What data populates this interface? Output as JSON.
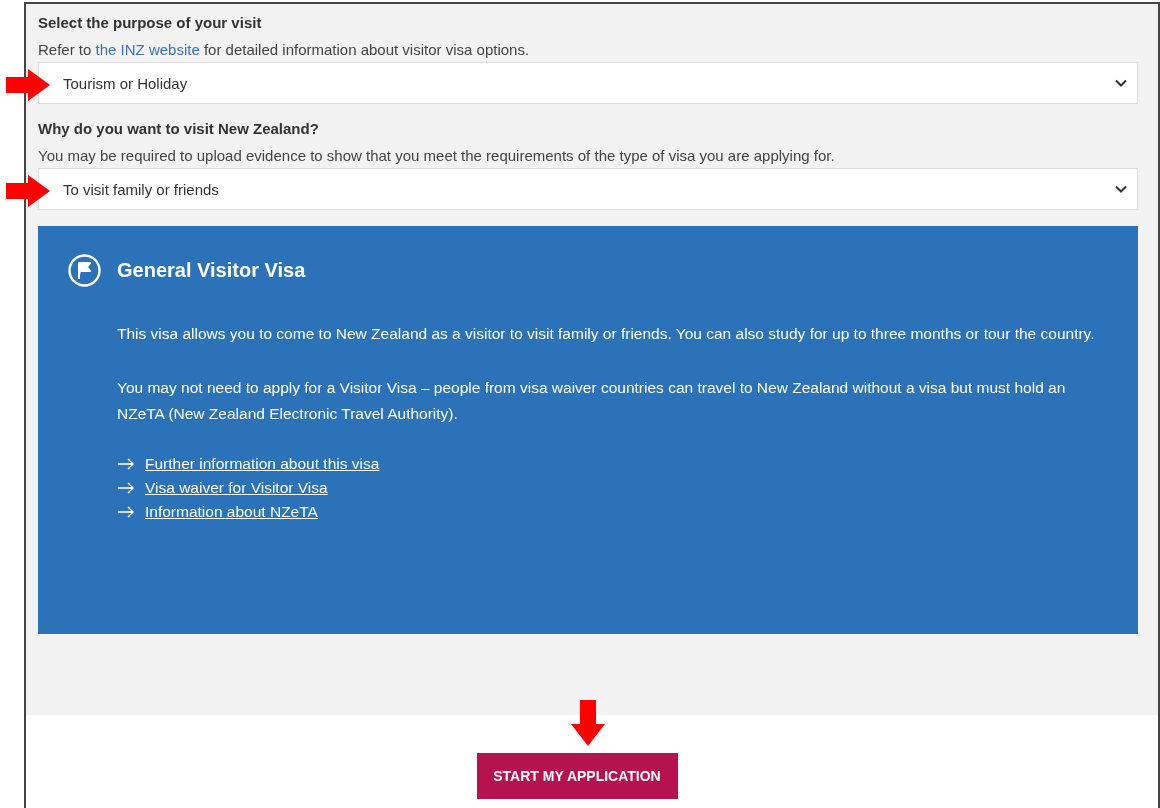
{
  "fields": [
    {
      "label": "Select the purpose of your visit",
      "help": [
        {
          "kind": "text",
          "text": "Refer to "
        },
        {
          "kind": "link",
          "text": "the INZ website"
        },
        {
          "kind": "text",
          "text": " for detailed information about visitor visa options."
        }
      ],
      "value": "Tourism or Holiday"
    },
    {
      "label": "Why do you want to visit New Zealand?",
      "help": [
        {
          "kind": "text",
          "text": "You may be required to upload evidence to show that you meet the requirements of the type of visa you are applying for."
        }
      ],
      "value": "To visit family or friends"
    }
  ],
  "result": {
    "title": "General Visitor Visa",
    "paragraphs": [
      "This visa allows you to come to New Zealand as a visitor to visit family or friends. You can also study for up to three months or tour the country.",
      "You may not need to apply for a Visitor Visa – people from visa waiver countries can travel to New Zealand without a visa but must hold an NZeTA (New Zealand Electronic Travel Authority)."
    ],
    "links": [
      "Further information about this visa",
      "Visa waiver for Visitor Visa",
      "Information about NZeTA"
    ]
  },
  "button": "START MY APPLICATION"
}
